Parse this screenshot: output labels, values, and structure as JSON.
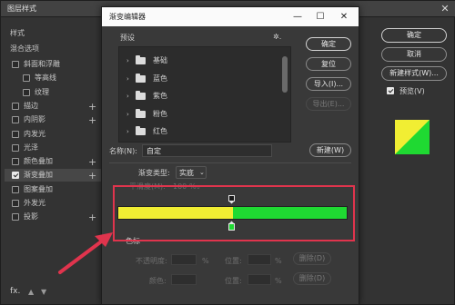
{
  "layer_style": {
    "title": "图层样式",
    "close_glyph": "✕",
    "section_styles": "样式",
    "section_blend": "混合选项",
    "items": [
      {
        "label": "斜面和浮雕",
        "checked": false,
        "plus": false
      },
      {
        "label": "等高线",
        "checked": false,
        "plus": false
      },
      {
        "label": "纹理",
        "checked": false,
        "plus": false
      },
      {
        "label": "描边",
        "checked": false,
        "plus": true
      },
      {
        "label": "内阴影",
        "checked": false,
        "plus": true
      },
      {
        "label": "内发光",
        "checked": false,
        "plus": false
      },
      {
        "label": "光泽",
        "checked": false,
        "plus": false
      },
      {
        "label": "颜色叠加",
        "checked": false,
        "plus": true
      },
      {
        "label": "渐变叠加",
        "checked": true,
        "plus": true
      },
      {
        "label": "图案叠加",
        "checked": false,
        "plus": false
      },
      {
        "label": "外发光",
        "checked": false,
        "plus": false
      },
      {
        "label": "投影",
        "checked": false,
        "plus": true
      }
    ],
    "fx_label": "fx.",
    "buttons": {
      "ok": "确定",
      "cancel": "取消",
      "new_style": "新建样式(W)..."
    },
    "preview": {
      "label": "预览(V)",
      "checked": true
    }
  },
  "gradient_editor": {
    "title": "渐变编辑器",
    "window_controls": {
      "minimize": "—",
      "maximize": "☐",
      "close": "✕"
    },
    "presets_label": "预设",
    "gear_glyph": "✲.",
    "presets": [
      {
        "label": "基础"
      },
      {
        "label": "蓝色"
      },
      {
        "label": "紫色"
      },
      {
        "label": "粉色"
      },
      {
        "label": "红色"
      }
    ],
    "buttons": {
      "ok": "确定",
      "reset": "复位",
      "import": "导入(I)...",
      "export": "导出(E)...",
      "new": "新建(W)"
    },
    "name_label": "名称(N):",
    "name_value": "自定",
    "type_label": "渐变类型:",
    "type_value": "实底",
    "smoothness_label": "平滑度(M):",
    "smoothness_value": "100",
    "smoothness_unit": "%",
    "stops_label": "色标",
    "opacity_label": "不透明度:",
    "opacity_unit": "%",
    "location_label": "位置:",
    "location_unit": "%",
    "delete_label": "删除(D)",
    "color_label": "颜色:",
    "stops": [
      {
        "color": "#f1ee33"
      },
      {
        "color": "#1fd932"
      }
    ]
  },
  "colors": {
    "highlight": "#e0344d",
    "yellow": "#f1ee33",
    "green": "#1fd932"
  }
}
